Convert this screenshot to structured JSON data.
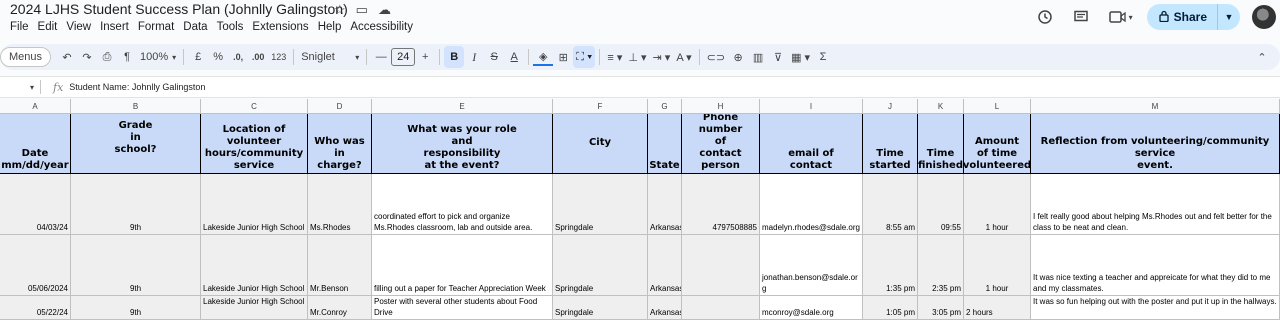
{
  "document": {
    "title": "2024 LJHS Student Success Plan (Johnlly Galingston)"
  },
  "menu": [
    "File",
    "Edit",
    "View",
    "Insert",
    "Format",
    "Data",
    "Tools",
    "Extensions",
    "Help",
    "Accessibility"
  ],
  "share": {
    "label": "Share"
  },
  "toolbar": {
    "menus_label": "Menus",
    "zoom": "100%",
    "currency": "£",
    "percent": "%",
    "dec_decrease": ".0,",
    "dec_increase": ".00",
    "number_format": "123",
    "font": "Sniglet",
    "font_size": "24",
    "bold": "B",
    "italic": "I",
    "strike": "S",
    "text_color": "A",
    "function": "Σ"
  },
  "formula_bar": {
    "fx": "fx",
    "content": "Student Name: Johnlly Galingston"
  },
  "columns": [
    "A",
    "B",
    "C",
    "D",
    "E",
    "F",
    "G",
    "H",
    "I",
    "J",
    "K",
    "L",
    "M"
  ],
  "headers": [
    "Date\nmm/dd/year",
    "Grade\nin\nschool?",
    "Location of\nvolunteer\nhours/community\nservice",
    "Who was in\ncharge?",
    "What was your role\nand\nresponsibility\nat the event?",
    "City",
    "State",
    "Phone\nnumber\nof\ncontact\nperson",
    "email of\ncontact",
    "Time\nstarted",
    "Time\nfinished",
    "Amount\nof time\nvolunteered",
    "Reflection from volunteering/community service\nevent."
  ],
  "rows": [
    {
      "date": "04/03/24",
      "grade": "9th",
      "location": "Lakeside Junior High School",
      "in_charge": "Ms.Rhodes",
      "role": "coordinated effort to pick and organize Ms.Rhodes classroom, lab and outside area.",
      "city": "Springdale",
      "state": "Arkansas",
      "phone": "4797508885",
      "email": "madelyn.rhodes@sdale.org",
      "time_started": "8:55 am",
      "time_finished": "09:55",
      "amount": "1 hour",
      "reflection": "I felt really good about helping Ms.Rhodes out and felt better for the class to be neat and clean."
    },
    {
      "date": "05/06/2024",
      "grade": "9th",
      "location": "Lakeside Junior High School",
      "in_charge": "Mr.Benson",
      "role": "filling out a paper for Teacher Appreciation Week",
      "city": "Springdale",
      "state": "Arkansas",
      "phone": "",
      "email": "jonathan.benson@sdale.org",
      "time_started": "1:35 pm",
      "time_finished": "2:35 pm",
      "amount": "1 hour",
      "reflection": "It was nice texting a teacher and appreicate for what they did to me and my classmates."
    },
    {
      "date": "05/22/24",
      "grade": "9th",
      "location": "Lakeside Junior High School",
      "in_charge": "Mr.Conroy",
      "role": "Poster with several other students about Food Drive",
      "city": "Springdale",
      "state": "Arkansas",
      "phone": "",
      "email": "mconroy@sdale.org",
      "time_started": "1:05 pm",
      "time_finished": "3:05 pm",
      "amount": "2 hours",
      "reflection": "It was so fun helping out with the poster and put it up in the hallways."
    }
  ]
}
